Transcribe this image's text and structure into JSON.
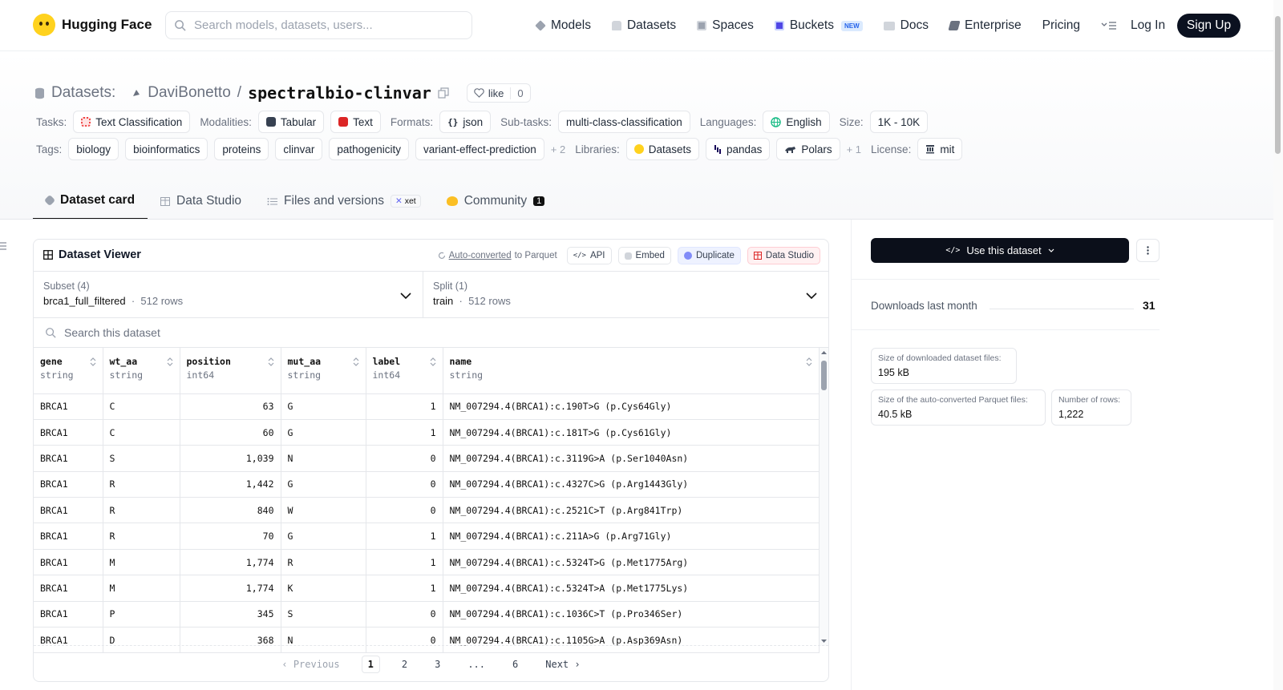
{
  "nav": {
    "logo_text": "Hugging Face",
    "search_placeholder": "Search models, datasets, users...",
    "links": [
      {
        "label": "Models",
        "icon": "models-icon",
        "color": "#9ca3af"
      },
      {
        "label": "Datasets",
        "icon": "datasets-icon",
        "color": "#d1d5db"
      },
      {
        "label": "Spaces",
        "icon": "spaces-icon",
        "color": "#9ca3af"
      },
      {
        "label": "Buckets",
        "icon": "buckets-icon",
        "color": "#4f46e5"
      },
      {
        "label": "Docs",
        "icon": "docs-icon",
        "color": "#9ca3af"
      },
      {
        "label": "Enterprise",
        "icon": "enterprise-icon",
        "color": "#6b7280"
      },
      {
        "label": "Pricing"
      }
    ],
    "new_badge": "NEW",
    "login": "Log In",
    "signup": "Sign Up"
  },
  "header": {
    "section": "Datasets:",
    "owner": "DaviBonetto",
    "separator": "/",
    "dataset_name": "spectralbio-clinvar",
    "like_label": "like",
    "like_count": "0"
  },
  "meta_row1": {
    "tasks_label": "Tasks:",
    "tasks": [
      "Text Classification"
    ],
    "modalities_label": "Modalities:",
    "modalities": [
      "Tabular",
      "Text"
    ],
    "formats_label": "Formats:",
    "formats": [
      "json"
    ],
    "subtasks_label": "Sub-tasks:",
    "subtasks": [
      "multi-class-classification"
    ],
    "languages_label": "Languages:",
    "languages": [
      "English"
    ],
    "size_label": "Size:",
    "size": [
      "1K - 10K"
    ]
  },
  "meta_row2": {
    "tags_label": "Tags:",
    "tags": [
      "biology",
      "bioinformatics",
      "proteins",
      "clinvar",
      "pathogenicity",
      "variant-effect-prediction"
    ],
    "tags_more": "+ 2",
    "libraries_label": "Libraries:",
    "libraries": [
      "Datasets",
      "pandas",
      "Polars"
    ],
    "libraries_more": "+ 1",
    "license_label": "License:",
    "license": "mit"
  },
  "tabs": {
    "dataset_card": "Dataset card",
    "data_studio": "Data Studio",
    "files": "Files and versions",
    "xet": "xet",
    "community": "Community",
    "community_count": "1"
  },
  "viewer": {
    "title": "Dataset Viewer",
    "auto_converted": "Auto-converted",
    "to_parquet": "to Parquet",
    "api": "API",
    "embed": "Embed",
    "duplicate": "Duplicate",
    "data_studio": "Data Studio",
    "subset_title": "Subset (4)",
    "subset_value": "brca1_full_filtered",
    "subset_rows": "512 rows",
    "split_title": "Split (1)",
    "split_value": "train",
    "split_rows": "512 rows",
    "search_placeholder": "Search this dataset",
    "columns": [
      {
        "name": "gene",
        "type": "string"
      },
      {
        "name": "wt_aa",
        "type": "string"
      },
      {
        "name": "position",
        "type": "int64"
      },
      {
        "name": "mut_aa",
        "type": "string"
      },
      {
        "name": "label",
        "type": "int64"
      },
      {
        "name": "name",
        "type": "string"
      }
    ],
    "rows": [
      [
        "BRCA1",
        "C",
        "63",
        "G",
        "1",
        "NM_007294.4(BRCA1):c.190T>G (p.Cys64Gly)"
      ],
      [
        "BRCA1",
        "C",
        "60",
        "G",
        "1",
        "NM_007294.4(BRCA1):c.181T>G (p.Cys61Gly)"
      ],
      [
        "BRCA1",
        "S",
        "1,039",
        "N",
        "0",
        "NM_007294.4(BRCA1):c.3119G>A (p.Ser1040Asn)"
      ],
      [
        "BRCA1",
        "R",
        "1,442",
        "G",
        "0",
        "NM_007294.4(BRCA1):c.4327C>G (p.Arg1443Gly)"
      ],
      [
        "BRCA1",
        "R",
        "840",
        "W",
        "0",
        "NM_007294.4(BRCA1):c.2521C>T (p.Arg841Trp)"
      ],
      [
        "BRCA1",
        "R",
        "70",
        "G",
        "1",
        "NM_007294.4(BRCA1):c.211A>G (p.Arg71Gly)"
      ],
      [
        "BRCA1",
        "M",
        "1,774",
        "R",
        "1",
        "NM_007294.4(BRCA1):c.5324T>G (p.Met1775Arg)"
      ],
      [
        "BRCA1",
        "M",
        "1,774",
        "K",
        "1",
        "NM_007294.4(BRCA1):c.5324T>A (p.Met1775Lys)"
      ],
      [
        "BRCA1",
        "P",
        "345",
        "S",
        "0",
        "NM_007294.4(BRCA1):c.1036C>T (p.Pro346Ser)"
      ],
      [
        "BRCA1",
        "D",
        "368",
        "N",
        "0",
        "NM_007294.4(BRCA1):c.1105G>A (p.Asp369Asn)"
      ]
    ],
    "pager": {
      "prev": "Previous",
      "pages": [
        "1",
        "2",
        "3",
        "...",
        "6"
      ],
      "next": "Next"
    }
  },
  "sidebar": {
    "use_button": "Use this dataset",
    "downloads_label": "Downloads last month",
    "downloads_value": "31",
    "stat1_label": "Size of downloaded dataset files:",
    "stat1_value": "195 kB",
    "stat2_label": "Size of the auto-converted Parquet files:",
    "stat2_value": "40.5 kB",
    "stat3_label": "Number of rows:",
    "stat3_value": "1,222"
  }
}
